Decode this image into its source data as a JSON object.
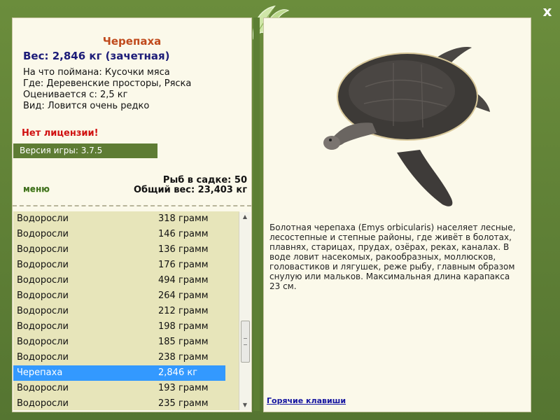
{
  "close_label": "x",
  "fish": {
    "title": "Черепаха",
    "weight": "Вес: 2,846 кг (зачетная)",
    "caught_on": "На что поймана: Кусочки мяса",
    "location": "Где: Деревенские просторы, Ряска",
    "rated_from": "Оценивается с: 2,5 кг",
    "kind": "Вид: Ловится очень редко",
    "description": "Болотная черепаха (Emys orbicularis) населяет лесные, лесостепные и степные районы, где живёт в болотах, плавнях, старицах, прудах, озёрах, реках, каналах. В воде ловит насекомых, ракообразных, моллюсков, головастиков и лягушек, реже рыбу, главным образом снулую или мальков. Максимальная длина карапакса 23 см."
  },
  "license_warning": "Нет лицензии!",
  "version": "Версия игры: 3.7.5",
  "menu_label": "меню",
  "stats": {
    "count": "Рыб в садке: 50",
    "total": "Общий вес: 23,403 кг"
  },
  "catch_list": [
    {
      "name": "Водоросли",
      "weight": "318 грамм"
    },
    {
      "name": "Водоросли",
      "weight": "146 грамм"
    },
    {
      "name": "Водоросли",
      "weight": "136 грамм"
    },
    {
      "name": "Водоросли",
      "weight": "176 грамм"
    },
    {
      "name": "Водоросли",
      "weight": "494 грамм"
    },
    {
      "name": "Водоросли",
      "weight": "264 грамм"
    },
    {
      "name": "Водоросли",
      "weight": "212 грамм"
    },
    {
      "name": "Водоросли",
      "weight": "198 грамм"
    },
    {
      "name": "Водоросли",
      "weight": "185 грамм"
    },
    {
      "name": "Водоросли",
      "weight": "238 грамм"
    },
    {
      "name": "Черепаха",
      "weight": "2,846 кг",
      "selected": true
    },
    {
      "name": "Водоросли",
      "weight": "193 грамм"
    },
    {
      "name": "Водоросли",
      "weight": "235 грамм"
    }
  ],
  "hotkeys_label": "Горячие клавиши",
  "colors": {
    "frame": "#5a7a34",
    "panel": "#fbf9ea",
    "list_bg": "#e7e5ba",
    "selected": "#3399ff",
    "title": "#c04a1c",
    "weight": "#1c1c78",
    "warning": "#d01010"
  }
}
